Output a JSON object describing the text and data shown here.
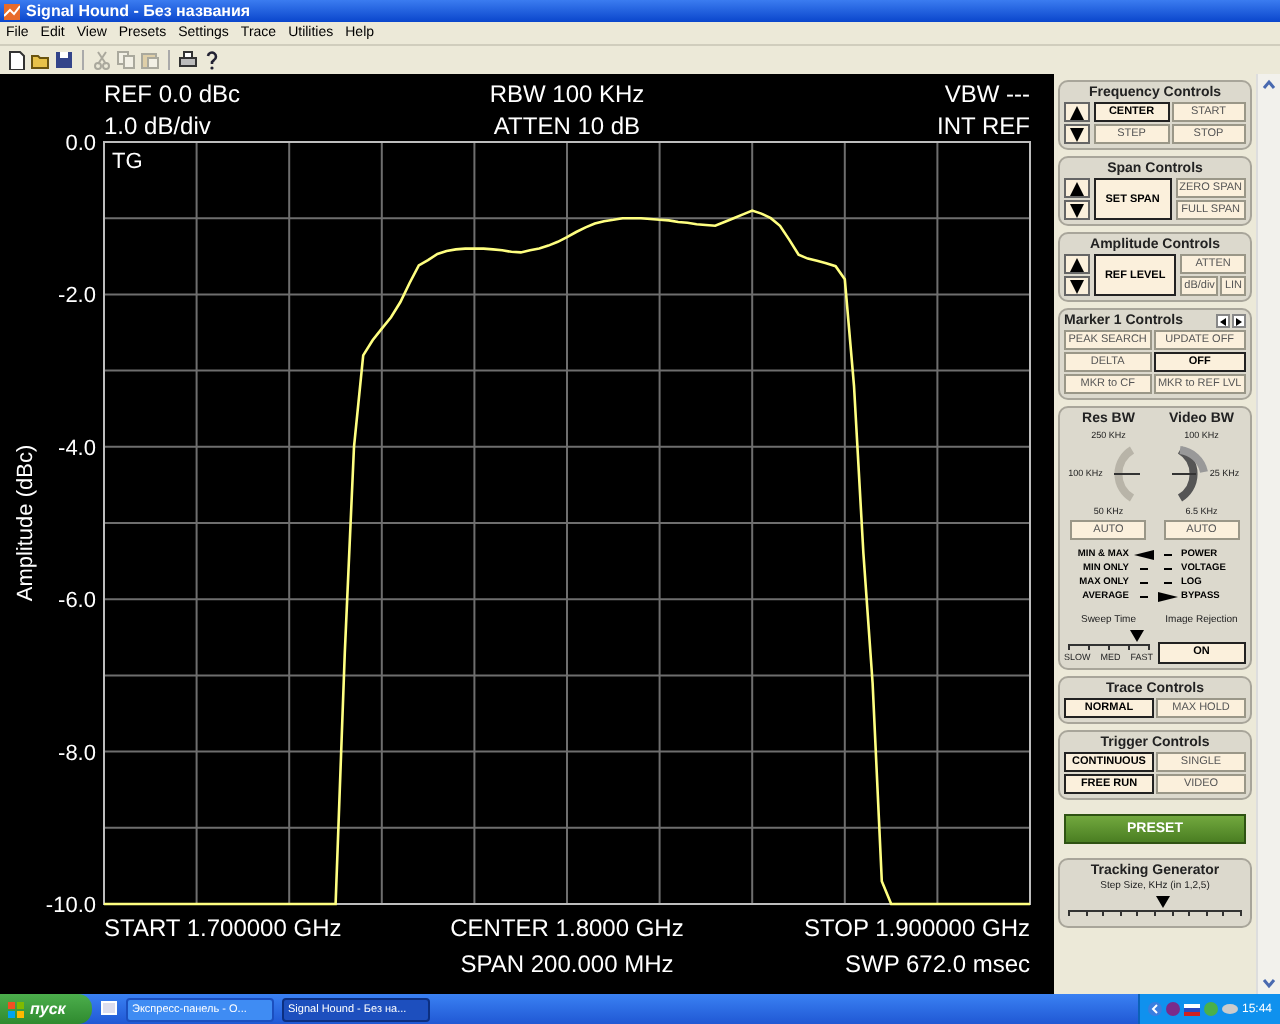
{
  "window": {
    "title": "Signal Hound - Без названия"
  },
  "menu": [
    "File",
    "Edit",
    "View",
    "Presets",
    "Settings",
    "Trace",
    "Utilities",
    "Help"
  ],
  "toolbar": [
    {
      "kind": "new",
      "disabled": false
    },
    {
      "kind": "open",
      "disabled": false
    },
    {
      "kind": "save",
      "disabled": false
    },
    {
      "kind": "cut",
      "disabled": true
    },
    {
      "kind": "copy",
      "disabled": true
    },
    {
      "kind": "paste",
      "disabled": true
    },
    {
      "kind": "print",
      "disabled": false
    },
    {
      "kind": "help",
      "disabled": false
    }
  ],
  "display": {
    "ref_level": "REF 0.0 dBc",
    "scale": "1.0 dB/div",
    "rbw": "RBW 100 KHz",
    "atten": "ATTEN 10 dB",
    "vbw": "VBW ---",
    "reference": "INT REF",
    "trace_label": "TG",
    "start": "START 1.700000 GHz",
    "center": "CENTER 1.8000 GHz",
    "span": "SPAN 200.000 MHz",
    "stop": "STOP 1.900000 GHz",
    "sweep": "SWP 672.0 msec",
    "chart_data": {
      "type": "line",
      "ylabel": "Amplitude (dBc)",
      "ylim": [
        -10,
        0
      ],
      "grid": true,
      "yticks": [
        {
          "value": 0,
          "label": "0.0"
        },
        {
          "value": -2,
          "label": "-2.0"
        },
        {
          "value": -4,
          "label": "-4.0"
        },
        {
          "value": -6,
          "label": "-6.0"
        },
        {
          "value": -8,
          "label": "-8.0"
        },
        {
          "value": -10,
          "label": "-10.0"
        }
      ],
      "categories": [
        null,
        null,
        null,
        null,
        null,
        null,
        null,
        null,
        null,
        null,
        null,
        null,
        null,
        null,
        null,
        null,
        null,
        null,
        null,
        null,
        null,
        null,
        null,
        null,
        null,
        null,
        null,
        null,
        null,
        null,
        null,
        null,
        null,
        null,
        null,
        null,
        null,
        null,
        null,
        null,
        null,
        null,
        null,
        null,
        null,
        null,
        null,
        null,
        null,
        null,
        null,
        null,
        null,
        null,
        null,
        null,
        null,
        null,
        null,
        null,
        null,
        null,
        null,
        null,
        null,
        null,
        null,
        null,
        null,
        null,
        null,
        null,
        null,
        null,
        null,
        null,
        null,
        null,
        null,
        null,
        null,
        null,
        null,
        null,
        null,
        null,
        null,
        null,
        null,
        null,
        null,
        null,
        null,
        null,
        null,
        null,
        null,
        null,
        null,
        null,
        null
      ],
      "series": [
        {
          "color": "#ffff80",
          "values": [
            -10,
            -10,
            -10,
            -10,
            -10,
            -10,
            -10,
            -10,
            -10,
            -10,
            -10,
            -10,
            -10,
            -10,
            -10,
            -10,
            -10,
            -10,
            -10,
            -10,
            -10,
            -10,
            -10,
            -10,
            -10,
            -10,
            -6.7,
            -4.0,
            -2.8,
            -2.6,
            -2.45,
            -2.3,
            -2.1,
            -1.85,
            -1.62,
            -1.55,
            -1.47,
            -1.43,
            -1.41,
            -1.4,
            -1.4,
            -1.4,
            -1.41,
            -1.42,
            -1.44,
            -1.45,
            -1.42,
            -1.4,
            -1.36,
            -1.31,
            -1.25,
            -1.18,
            -1.12,
            -1.07,
            -1.04,
            -1.02,
            -1.0,
            -1.0,
            -1.0,
            -1.01,
            -1.02,
            -1.03,
            -1.05,
            -1.06,
            -1.08,
            -1.09,
            -1.1,
            -1.05,
            -1.0,
            -0.95,
            -0.9,
            -0.94,
            -1.0,
            -1.1,
            -1.28,
            -1.48,
            -1.53,
            -1.56,
            -1.59,
            -1.63,
            -1.8,
            -3.2,
            -5.4,
            -7.1,
            -9.7,
            -10,
            -10,
            -10,
            -10,
            -10,
            -10,
            -10,
            -10,
            -10,
            -10,
            -10,
            -10,
            -10,
            -10,
            -10,
            -10
          ]
        }
      ]
    }
  },
  "frequency": {
    "title": "Frequency Controls",
    "buttons": [
      {
        "label": "CENTER",
        "selected": true
      },
      {
        "label": "START",
        "selected": false
      },
      {
        "label": "STEP",
        "selected": false
      },
      {
        "label": "STOP",
        "selected": false
      }
    ]
  },
  "span": {
    "title": "Span Controls",
    "main": {
      "label": "SET SPAN",
      "selected": true
    },
    "buttons": [
      {
        "label": "ZERO SPAN",
        "selected": false
      },
      {
        "label": "FULL SPAN",
        "selected": false
      }
    ]
  },
  "amplitude": {
    "title": "Amplitude Controls",
    "main": {
      "label": "REF LEVEL",
      "selected": true
    },
    "buttons": [
      {
        "label": "ATTEN",
        "selected": false
      },
      {
        "label": "dB/div",
        "selected": false
      },
      {
        "label": "LIN",
        "selected": false
      }
    ]
  },
  "marker": {
    "title": "Marker 1 Controls",
    "buttons": [
      {
        "label": "PEAK SEARCH",
        "selected": false
      },
      {
        "label": "UPDATE OFF",
        "selected": false
      },
      {
        "label": "DELTA",
        "selected": false
      },
      {
        "label": "OFF",
        "selected": true
      },
      {
        "label": "MKR to CF",
        "selected": false
      },
      {
        "label": "MKR to REF LVL",
        "selected": false
      }
    ]
  },
  "bandwidth": {
    "res": {
      "title": "Res BW",
      "scale": [
        "250 KHz",
        "100 KHz",
        "50 KHz"
      ],
      "button": "AUTO"
    },
    "video": {
      "title": "Video BW",
      "scale": [
        "100 KHz",
        "25 KHz",
        "6.5 KHz"
      ],
      "button": "AUTO"
    },
    "trace_modes": [
      {
        "label": "MIN & MAX",
        "selected": true
      },
      {
        "label": "MIN ONLY",
        "selected": false
      },
      {
        "label": "MAX ONLY",
        "selected": false
      },
      {
        "label": "AVERAGE",
        "selected": false
      }
    ],
    "detectors": [
      {
        "label": "POWER",
        "selected": false
      },
      {
        "label": "VOLTAGE",
        "selected": false
      },
      {
        "label": "LOG",
        "selected": false
      },
      {
        "label": "BYPASS",
        "selected": true
      }
    ],
    "sweep_time": {
      "title": "Sweep Time",
      "level": 0.85,
      "ticks": [
        "SLOW",
        "MED",
        "FAST"
      ]
    },
    "image_rejection": {
      "title": "Image Rejection",
      "button": "ON"
    }
  },
  "trace": {
    "title": "Trace Controls",
    "buttons": [
      {
        "label": "NORMAL",
        "selected": true
      },
      {
        "label": "MAX HOLD",
        "selected": false
      }
    ]
  },
  "trigger": {
    "title": "Trigger Controls",
    "buttons": [
      {
        "label": "CONTINUOUS",
        "selected": true
      },
      {
        "label": "SINGLE",
        "selected": false
      },
      {
        "label": "FREE RUN",
        "selected": true
      },
      {
        "label": "VIDEO",
        "selected": false
      }
    ]
  },
  "preset": "PRESET",
  "tracking": {
    "title": "Tracking Generator",
    "caption": "Step Size, KHz (in 1,2,5)",
    "level": 0.55
  },
  "taskbar": {
    "start": "пуск",
    "tasks": [
      {
        "label": "Экспресс-панель - О...",
        "selected": false
      },
      {
        "label": "Signal Hound - Без на...",
        "selected": true
      }
    ],
    "clock": "15:44"
  }
}
